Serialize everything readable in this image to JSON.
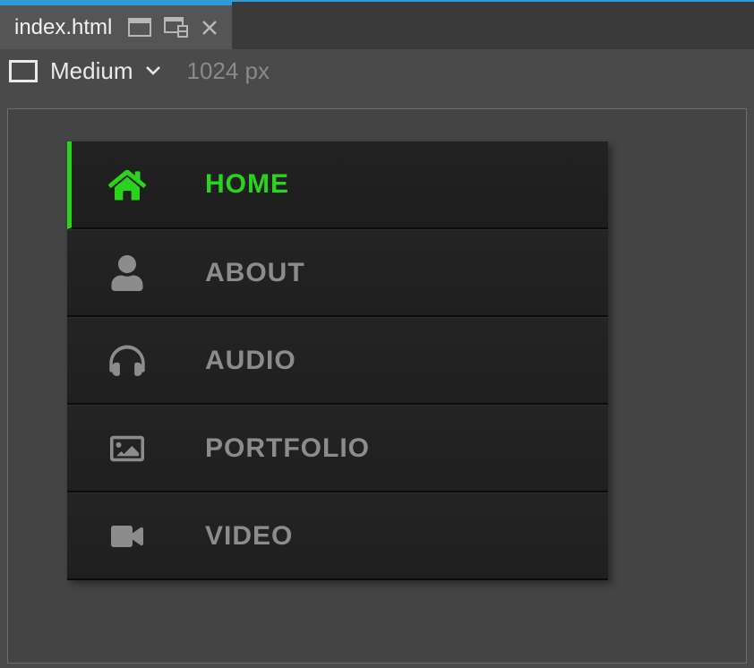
{
  "tab": {
    "filename": "index.html"
  },
  "breakpoint": {
    "label": "Medium",
    "width": "1024 px"
  },
  "menu": {
    "items": [
      {
        "label": "HOME",
        "icon": "home",
        "active": true
      },
      {
        "label": "ABOUT",
        "icon": "user",
        "active": false
      },
      {
        "label": "AUDIO",
        "icon": "headphones",
        "active": false
      },
      {
        "label": "PORTFOLIO",
        "icon": "image",
        "active": false
      },
      {
        "label": "VIDEO",
        "icon": "video",
        "active": false
      }
    ]
  }
}
